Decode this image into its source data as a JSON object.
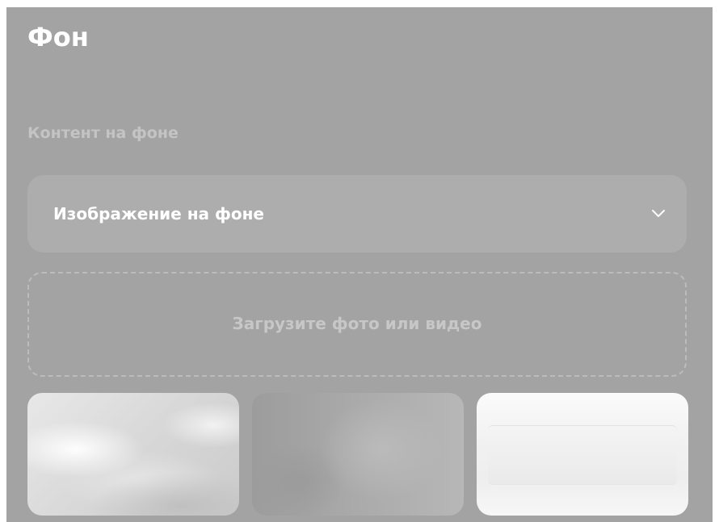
{
  "panel": {
    "title": "Фон",
    "section_label": "Контент на фоне",
    "select": {
      "value": "Изображение на фоне",
      "icon": "chevron-down-icon"
    },
    "upload": {
      "label": "Загрузите фото или видео"
    },
    "thumbnails": [
      {
        "name": "white-clouds-background"
      },
      {
        "name": "gray-blurred-background"
      },
      {
        "name": "white-gradient-background"
      }
    ]
  },
  "colors": {
    "panel_bg": "#a3a3a3",
    "select_bg": "#adadad",
    "title": "#ffffff",
    "muted_text": "#c4c4c4"
  }
}
